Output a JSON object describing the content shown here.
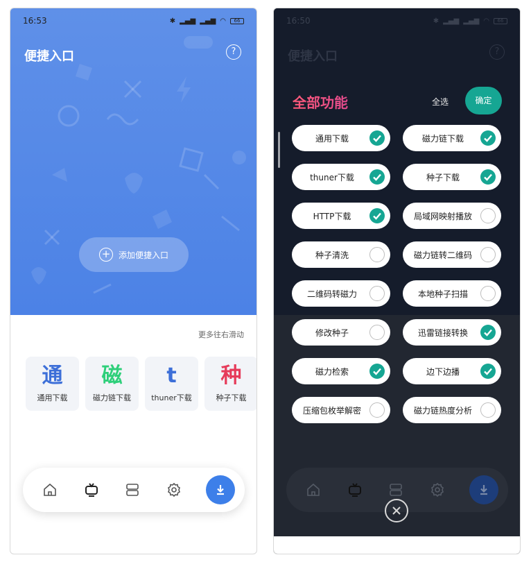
{
  "left": {
    "status": {
      "time": "16:53",
      "battery": "66"
    },
    "title": "便捷入口",
    "help_icon": "?",
    "add_entry": "添加便捷入口",
    "scroll_hint": "更多往右滑动",
    "cards": [
      {
        "glyph": "通",
        "label": "通用下载",
        "color": "#3d6fd8"
      },
      {
        "glyph": "磁",
        "label": "磁力链下载",
        "color": "#2ecf7a"
      },
      {
        "glyph": "t",
        "label": "thuner下载",
        "color": "#3d6fd8"
      },
      {
        "glyph": "种",
        "label": "种子下载",
        "color": "#e63b5a"
      }
    ],
    "tabs": [
      "home-icon",
      "tv-icon",
      "cards-icon",
      "gear-icon",
      "download-icon"
    ]
  },
  "right": {
    "status": {
      "time": "16:50",
      "battery": "66"
    },
    "title": "便捷入口",
    "panel_title": "全部功能",
    "select_all": "全选",
    "confirm": "确定",
    "features": [
      {
        "label": "通用下载",
        "checked": true
      },
      {
        "label": "磁力链下载",
        "checked": true
      },
      {
        "label": "thuner下载",
        "checked": true
      },
      {
        "label": "种子下载",
        "checked": true
      },
      {
        "label": "HTTP下载",
        "checked": true
      },
      {
        "label": "局域网映射播放",
        "checked": false
      },
      {
        "label": "种子清洗",
        "checked": false
      },
      {
        "label": "磁力链转二维码",
        "checked": false
      },
      {
        "label": "二维码转磁力",
        "checked": false
      },
      {
        "label": "本地种子扫描",
        "checked": false
      },
      {
        "label": "修改种子",
        "checked": false
      },
      {
        "label": "迅雷链接转换",
        "checked": true
      },
      {
        "label": "磁力检索",
        "checked": true
      },
      {
        "label": "边下边播",
        "checked": true
      },
      {
        "label": "压缩包枚举解密",
        "checked": false
      },
      {
        "label": "磁力链热度分析",
        "checked": false
      }
    ],
    "colors": {
      "accent": "#16a693",
      "title_gradient_start": "#ff5a7a",
      "title_gradient_end": "#e24a8d"
    }
  }
}
